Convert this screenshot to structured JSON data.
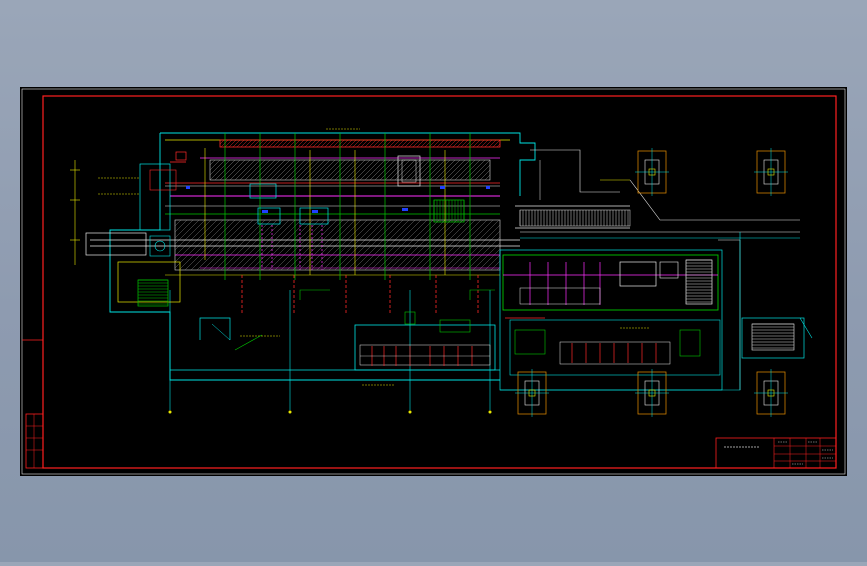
{
  "background_color": "#8e9bb0",
  "sheet": {
    "paper_color": "#000000",
    "frame_color": "#ff2020"
  },
  "colors": {
    "cyan": "#00e5e5",
    "yellow": "#e8e800",
    "green": "#00c800",
    "magenta": "#ff30ff",
    "red": "#ff2a2a",
    "white": "#e8e8e8",
    "blue": "#2040ff",
    "orange": "#e08000"
  },
  "title_block": {
    "drawing_name": "",
    "sheet_label": "",
    "designer_label": "",
    "checker_label": "",
    "scale_label": "",
    "date_label": ""
  },
  "revision_box": {
    "label": ""
  },
  "drawing_title": "",
  "annotations": {
    "top_note": "",
    "left_note_1": "",
    "left_note_2": "",
    "mid_note": "",
    "center_note": ""
  }
}
